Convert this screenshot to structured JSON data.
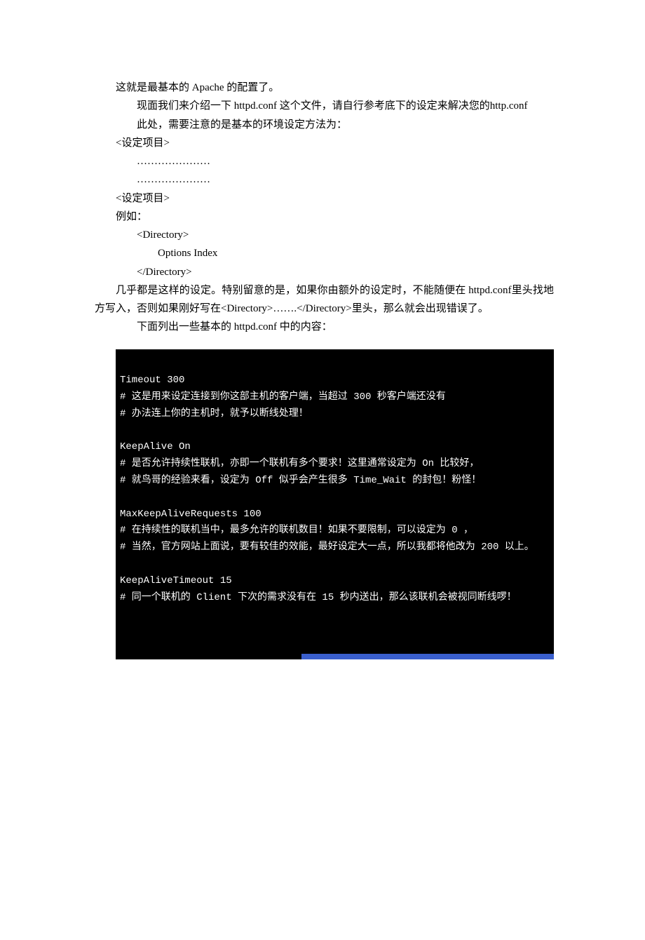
{
  "p1": "这就是最基本的 Apache 的配置了。",
  "p2": "现面我们来介绍一下 httpd.conf 这个文件，请自行参考底下的设定来解决您的http.conf",
  "p3": "此处，需要注意的是基本的环境设定方法为：",
  "l1": "<设定项目>",
  "l2": "…………………",
  "l3": "…………………",
  "l4": "<设定项目>",
  "l5": "例如：",
  "l6": "<Directory>",
  "l7": "Options Index",
  "l8": "</Directory>",
  "p4": "几乎都是这样的设定。特别留意的是，如果你由额外的设定时，不能随便在 httpd.conf里头找地方写入，否则如果刚好写在<Directory>…….</Directory>里头，那么就会出现错误了。",
  "p5": "下面列出一些基本的 httpd.conf 中的内容：",
  "code": {
    "c01": "Timeout 300",
    "c02": "# 这是用来设定连接到你这部主机的客户端，当超过 300 秒客户端还没有",
    "c03": "# 办法连上你的主机时，就予以断线处理！",
    "c04": "",
    "c05": "KeepAlive On",
    "c06": "# 是否允许持续性联机，亦即一个联机有多个要求！这里通常设定为 On 比较好，",
    "c07": "# 就鸟哥的经验来看，设定为 Off 似乎会产生很多 Time_Wait 的封包！粉怪！",
    "c08": "",
    "c09": "MaxKeepAliveRequests 100",
    "c10": "# 在持续性的联机当中，最多允许的联机数目！如果不要限制，可以设定为 0 ，",
    "c11": "# 当然，官方网站上面说，要有较佳的效能，最好设定大一点，所以我都将他改为 200 以上。",
    "c12": "",
    "c13": "KeepAliveTimeout 15",
    "c14": "# 同一个联机的 Client 下次的需求没有在 15 秒内送出，那么该联机会被视同断线啰！"
  }
}
